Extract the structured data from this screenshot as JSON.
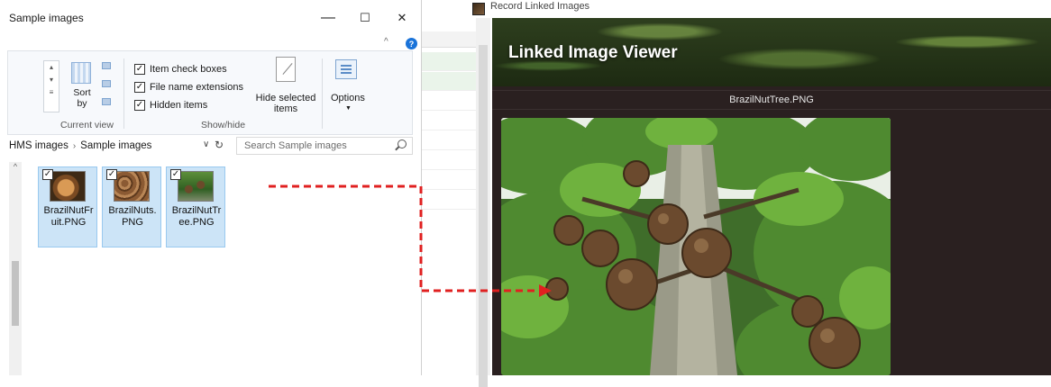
{
  "explorer": {
    "title": "Sample images",
    "minimize_glyph": "—",
    "maximize_glyph": "☐",
    "close_glyph": "✕",
    "ribbon_collapse_glyph": "^",
    "help_glyph": "?",
    "ribbon": {
      "sort_label": "Sort by",
      "current_view_label": "Current view",
      "show_hide_label": "Show/hide",
      "checkboxes": [
        {
          "label": "Item check boxes",
          "checked": true
        },
        {
          "label": "File name extensions",
          "checked": true
        },
        {
          "label": "Hidden items",
          "checked": true
        }
      ],
      "hide_selected_label": "Hide selected items",
      "options_label": "Options",
      "check_glyph": "✓"
    },
    "address": {
      "crumbs": [
        "HMS images",
        "Sample images"
      ],
      "separator": "›",
      "dropdown_glyph": "∨",
      "refresh_glyph": "↻",
      "search_placeholder": "Search Sample images"
    },
    "files": [
      {
        "name": "BrazilNutFruit.PNG",
        "display": "BrazilNutFr uit.PNG",
        "checked": true,
        "selected": true
      },
      {
        "name": "BrazilNuts.PNG",
        "display": "BrazilNuts. PNG",
        "checked": true,
        "selected": true
      },
      {
        "name": "BrazilNutTree.PNG",
        "display": "BrazilNutTr ee.PNG",
        "checked": true,
        "selected": true
      }
    ]
  },
  "viewer": {
    "window_title": "Record Linked Images",
    "heading": "Linked Image Viewer",
    "filename": "BrazilNutTree.PNG"
  },
  "colors": {
    "selection_fill": "#cce4f7",
    "viewer_bg": "#2a2020",
    "arrow": "#e02020"
  },
  "icons": [
    "search-icon",
    "refresh-icon",
    "help-icon",
    "sort-icon",
    "options-icon",
    "hide-selected-icon"
  ]
}
